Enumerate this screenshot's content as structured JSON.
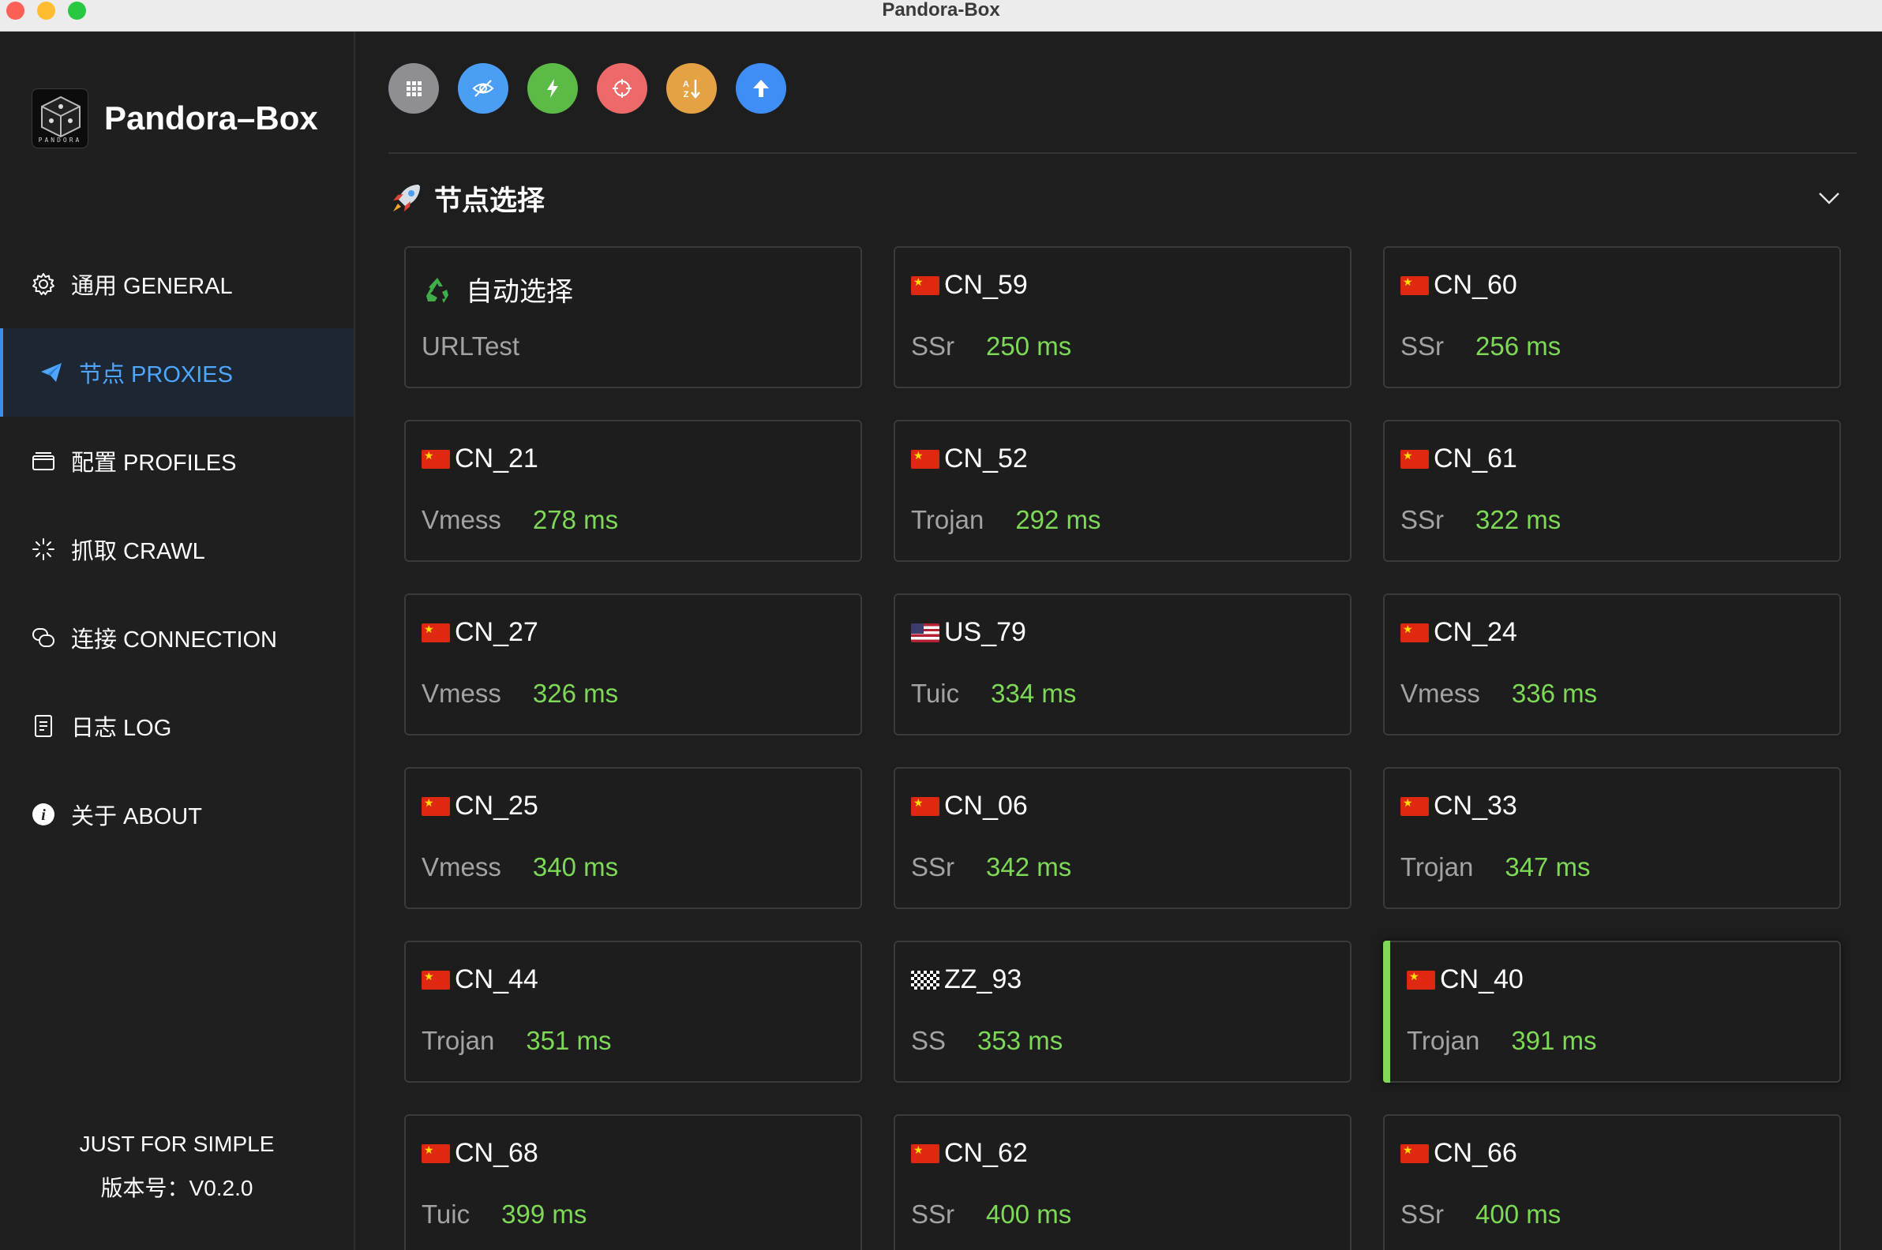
{
  "window": {
    "title": "Pandora-Box"
  },
  "brand": {
    "name": "Pandora–Box",
    "logo_text": "PANDORA"
  },
  "nav": [
    {
      "label": "通用 GENERAL",
      "icon": "gear-icon",
      "active": false
    },
    {
      "label": "节点 PROXIES",
      "icon": "paper-plane-icon",
      "active": true
    },
    {
      "label": "配置 PROFILES",
      "icon": "folder-icon",
      "active": false
    },
    {
      "label": "抓取 CRAWL",
      "icon": "spinner-icon",
      "active": false
    },
    {
      "label": "连接 CONNECTION",
      "icon": "chat-bubbles-icon",
      "active": false
    },
    {
      "label": "日志 LOG",
      "icon": "document-icon",
      "active": false
    },
    {
      "label": "关于 ABOUT",
      "icon": "info-icon",
      "active": false
    }
  ],
  "footer": {
    "tagline": "JUST FOR SIMPLE",
    "version": "版本号：V0.2.0"
  },
  "toolbar": [
    {
      "icon": "grid-icon",
      "color": "#8e8e93"
    },
    {
      "icon": "eye-slash-icon",
      "color": "#4a9ff5"
    },
    {
      "icon": "lightning-icon",
      "color": "#5cbb47"
    },
    {
      "icon": "target-icon",
      "color": "#ee6a6a"
    },
    {
      "icon": "sort-icon",
      "color": "#e4a245"
    },
    {
      "icon": "upload-arrow-icon",
      "color": "#3f8ef5"
    }
  ],
  "section": {
    "icon": "rocket-icon",
    "title": "节点选择"
  },
  "colors": {
    "accent": "#4ea6ff",
    "latency": "#7ed957",
    "selected_bar": "#7ed957"
  },
  "proxies": [
    {
      "name": "自动选择",
      "flag": "recycle",
      "type": "URLTest",
      "latency": ""
    },
    {
      "name": "CN_59",
      "flag": "cn",
      "type": "SSr",
      "latency": "250 ms"
    },
    {
      "name": "CN_60",
      "flag": "cn",
      "type": "SSr",
      "latency": "256 ms"
    },
    {
      "name": "CN_21",
      "flag": "cn",
      "type": "Vmess",
      "latency": "278 ms"
    },
    {
      "name": "CN_52",
      "flag": "cn",
      "type": "Trojan",
      "latency": "292 ms"
    },
    {
      "name": "CN_61",
      "flag": "cn",
      "type": "SSr",
      "latency": "322 ms"
    },
    {
      "name": "CN_27",
      "flag": "cn",
      "type": "Vmess",
      "latency": "326 ms"
    },
    {
      "name": "US_79",
      "flag": "us",
      "type": "Tuic",
      "latency": "334 ms"
    },
    {
      "name": "CN_24",
      "flag": "cn",
      "type": "Vmess",
      "latency": "336 ms"
    },
    {
      "name": "CN_25",
      "flag": "cn",
      "type": "Vmess",
      "latency": "340 ms"
    },
    {
      "name": "CN_06",
      "flag": "cn",
      "type": "SSr",
      "latency": "342 ms"
    },
    {
      "name": "CN_33",
      "flag": "cn",
      "type": "Trojan",
      "latency": "347 ms"
    },
    {
      "name": "CN_44",
      "flag": "cn",
      "type": "Trojan",
      "latency": "351 ms"
    },
    {
      "name": "ZZ_93",
      "flag": "checkered",
      "type": "SS",
      "latency": "353 ms"
    },
    {
      "name": "CN_40",
      "flag": "cn",
      "type": "Trojan",
      "latency": "391 ms",
      "selected": true
    },
    {
      "name": "CN_68",
      "flag": "cn",
      "type": "Tuic",
      "latency": "399 ms"
    },
    {
      "name": "CN_62",
      "flag": "cn",
      "type": "SSr",
      "latency": "400 ms"
    },
    {
      "name": "CN_66",
      "flag": "cn",
      "type": "SSr",
      "latency": "400 ms"
    }
  ]
}
